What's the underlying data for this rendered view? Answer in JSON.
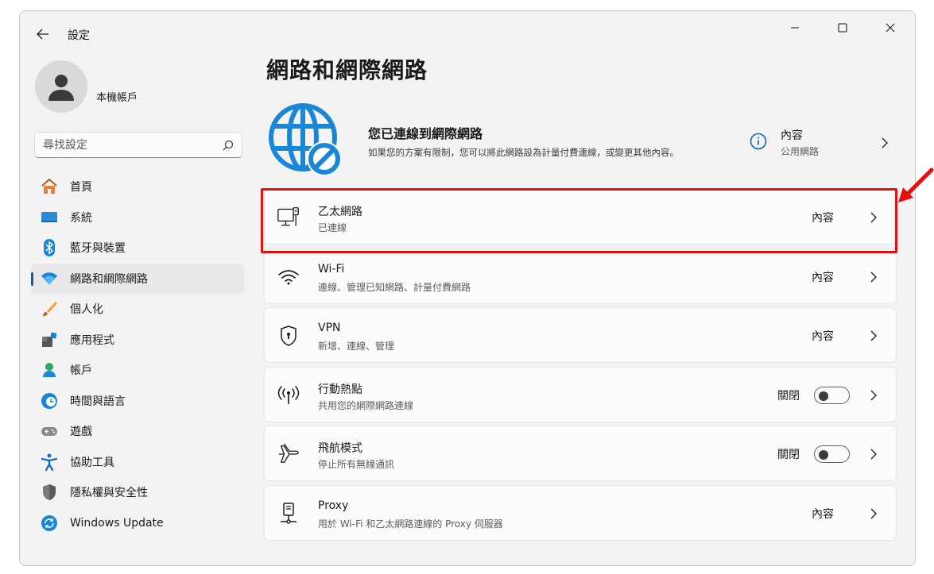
{
  "window": {
    "title": "設定"
  },
  "account": {
    "name": "本機帳戶"
  },
  "search": {
    "placeholder": "尋找設定"
  },
  "sidebar": {
    "items": [
      {
        "label": "首頁",
        "icon": "home-icon"
      },
      {
        "label": "系統",
        "icon": "system-icon"
      },
      {
        "label": "藍牙與裝置",
        "icon": "bluetooth-icon"
      },
      {
        "label": "網路和網際網路",
        "icon": "network-wifi-icon",
        "active": true
      },
      {
        "label": "個人化",
        "icon": "brush-icon"
      },
      {
        "label": "應用程式",
        "icon": "apps-icon"
      },
      {
        "label": "帳戶",
        "icon": "person-icon"
      },
      {
        "label": "時間與語言",
        "icon": "clock-globe-icon"
      },
      {
        "label": "遊戲",
        "icon": "gamepad-icon"
      },
      {
        "label": "協助工具",
        "icon": "accessibility-icon"
      },
      {
        "label": "隱私權與安全性",
        "icon": "shield-icon"
      },
      {
        "label": "Windows Update",
        "icon": "update-icon"
      }
    ]
  },
  "main": {
    "title": "網路和網際網路",
    "hero": {
      "title": "您已連線到網際網路",
      "description": "如果您的方案有限制，您可以將此網路設為計量付費連線，或變更其他內容。",
      "property_label": "內容",
      "property_sub": "公用網路"
    },
    "cards": [
      {
        "title": "乙太網路",
        "subtitle": "已連線",
        "right": "內容",
        "icon": "ethernet-icon"
      },
      {
        "title": "Wi-Fi",
        "subtitle": "連線、管理已知網路、計量付費網路",
        "right": "內容",
        "icon": "wifi-icon"
      },
      {
        "title": "VPN",
        "subtitle": "新增、連線、管理",
        "right": "內容",
        "icon": "vpn-shield-icon"
      },
      {
        "title": "行動熱點",
        "subtitle": "共用您的網際網路連線",
        "right": "關閉",
        "toggle": false,
        "icon": "hotspot-icon"
      },
      {
        "title": "飛航模式",
        "subtitle": "停止所有無線通訊",
        "right": "關閉",
        "toggle": false,
        "icon": "airplane-icon"
      },
      {
        "title": "Proxy",
        "subtitle": "用於 Wi-Fi 和乙太網路連線的 Proxy 伺服器",
        "right": "內容",
        "icon": "proxy-icon"
      }
    ]
  },
  "colors": {
    "accent": "#005fb8",
    "globe": "#1a86d6",
    "highlight": "#e31010"
  }
}
